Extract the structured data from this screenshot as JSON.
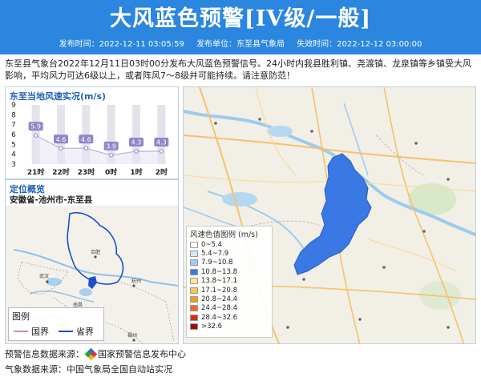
{
  "header": {
    "title": "大风蓝色预警[IV级/一般]",
    "publish_time": "发布时间：2022-12-11 03:05:59",
    "publisher": "发布单位：东至县气象局",
    "expire_time": "失效时间：2022-12-12 03:00:00"
  },
  "description": "东至县气象台2022年12月11日03时00分发布大风蓝色预警信号。24小时内我县胜利镇、尧渡镇、龙泉镇等乡镇受大风影响，平均风力可达6级以上，或者阵风7～8级并可能持续。请注意防范！",
  "wind_panel": {
    "title": "东至当地风速实况(m/s)"
  },
  "chart_data": {
    "type": "line",
    "title": "东至当地风速实况(m/s)",
    "categories": [
      "21时",
      "22时",
      "23时",
      "0时",
      "1时",
      "2时"
    ],
    "values": [
      5.9,
      4.6,
      4.6,
      3.9,
      4.3,
      4.3
    ],
    "yticks": [
      3,
      4,
      5,
      6,
      7,
      8,
      9
    ],
    "ylim": [
      3,
      9
    ],
    "grid": false
  },
  "location_panel": {
    "title": "定位概览",
    "region": "安徽省-池州市-东至县",
    "map_labels": [
      "合肥",
      "武汉",
      "杭州",
      "南昌",
      "福州"
    ],
    "legend_title": "图例",
    "legend_items": [
      {
        "label": "国界",
        "color": "#c98fa8"
      },
      {
        "label": "省界",
        "color": "#1e4fcc"
      }
    ]
  },
  "map": {
    "legend_title": "风速色值图例 (m/s)",
    "legend_items": [
      {
        "label": "0~5.4",
        "color": "#ffffff"
      },
      {
        "label": "5.4~7.9",
        "color": "#d6e6f7"
      },
      {
        "label": "7.9~10.8",
        "color": "#a9c8ef"
      },
      {
        "label": "10.8~13.8",
        "color": "#3a78e3"
      },
      {
        "label": "13.8~17.1",
        "color": "#fde79a"
      },
      {
        "label": "17.1~20.8",
        "color": "#fbc74c"
      },
      {
        "label": "20.8~24.4",
        "color": "#f59b1f"
      },
      {
        "label": "24.4~28.4",
        "color": "#ef6a1d"
      },
      {
        "label": "28.4~32.6",
        "color": "#dc2a16"
      },
      {
        "label": ">32.6",
        "color": "#9a0d0d"
      }
    ],
    "warning_color": "#3a78e3"
  },
  "footer": {
    "source1_label": "预警信息数据来源：",
    "source1_value": "国家预警信息发布中心",
    "source2": "气象数据来源：中国气象局全国自动站实况"
  }
}
